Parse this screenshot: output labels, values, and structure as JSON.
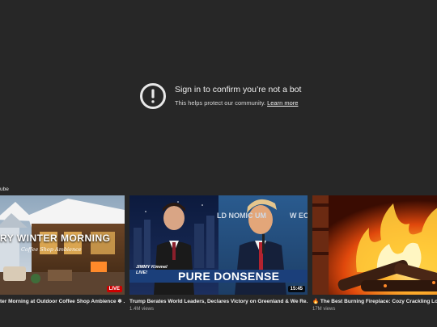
{
  "error": {
    "title": "Sign in to confirm you’re not a bot",
    "subtitle": "This helps protect our community.",
    "link": "Learn more",
    "icon": "alert-circle-icon"
  },
  "shelf": {
    "channel_label": "ube",
    "videos": [
      {
        "title": "ter Morning at Outdoor Coffee Shop Ambience ❄ ...",
        "views": "",
        "badge": "LIVE",
        "overlay_text": "RY WINTER MORNING",
        "overlay_sub": "Coffee Shop Ambience"
      },
      {
        "title": "Trump Berates World Leaders, Declares Victory on Greenland & We Re...",
        "views": "1.4M views",
        "badge": "15:45",
        "overlay_text": "PURE DONSENSE",
        "overlay_logo": "JIMMY Kimmel LIVE!",
        "overlay_bg": "LD NOMIC UM",
        "overlay_bg2": "W EC FOR"
      },
      {
        "title": "🔥 The Best Burning Fireplace: Cozy Crackling Logs",
        "views": "17M views",
        "badge": ""
      }
    ]
  },
  "colors": {
    "background": "#272727",
    "live": "#cc0000",
    "text": "#f1f1f1",
    "meta": "#aaaaaa"
  }
}
